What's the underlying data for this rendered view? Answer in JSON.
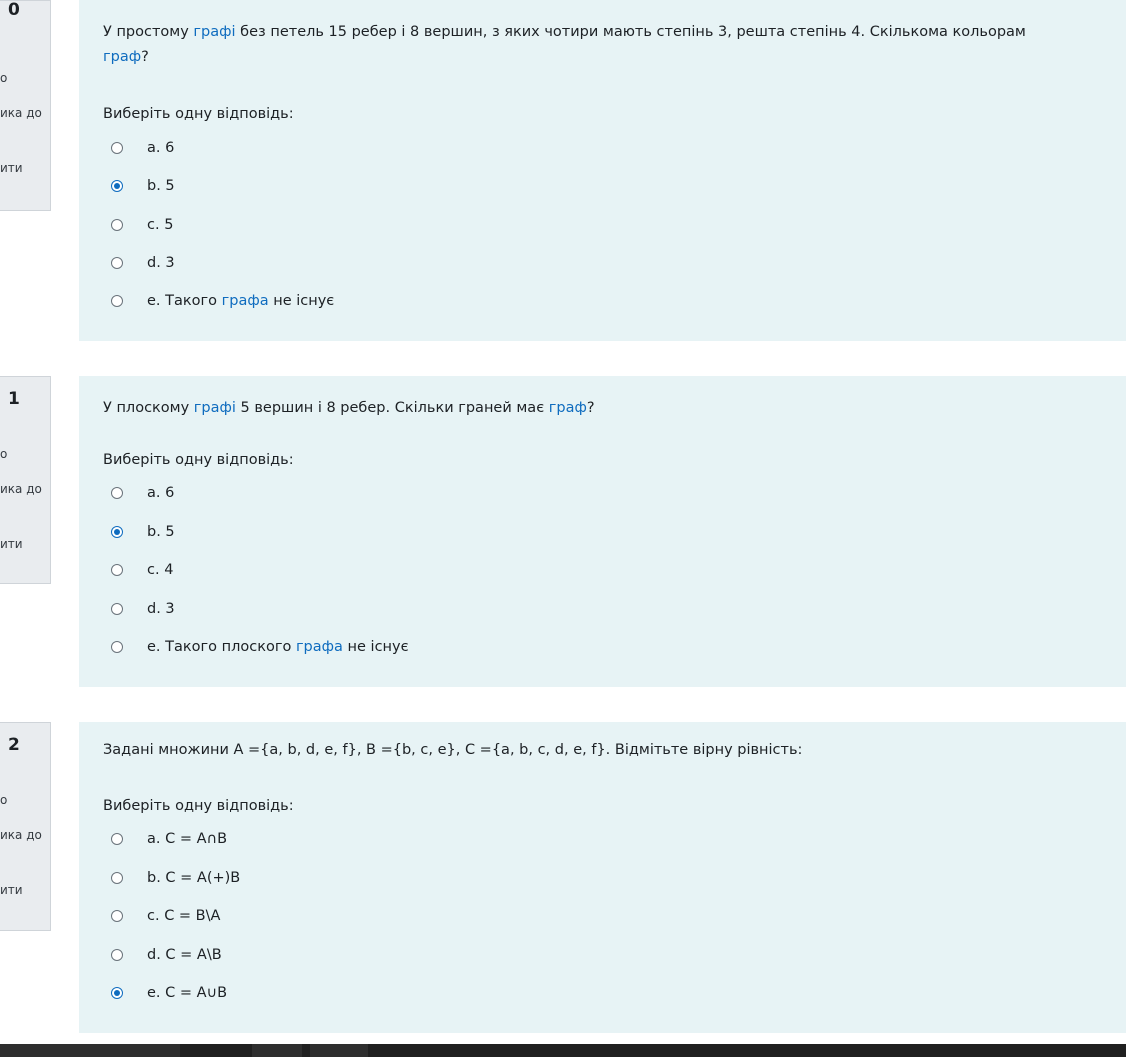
{
  "questions": [
    {
      "number": "0",
      "info": {
        "line1": "о",
        "line2": "ика до",
        "line3": "ити"
      },
      "text_parts": [
        {
          "t": "У простому ",
          "link": false
        },
        {
          "t": "графі",
          "link": true
        },
        {
          "t": " без петель 15 ребер і 8 вершин, з яких чотири мають степінь 3, решта степінь 4. Скількома кольорам",
          "link": false
        }
      ],
      "text_line2": "граф",
      "text_line2_tail": "?",
      "prompt": "Виберіть одну відповідь:",
      "answers": [
        {
          "label": "a. 6",
          "checked": false
        },
        {
          "label": "b. 5",
          "checked": true
        },
        {
          "label": "c. 5",
          "checked": false
        },
        {
          "label": "d. 3",
          "checked": false
        },
        {
          "label_pre": "e. Такого ",
          "label_link": "графа",
          "label_post": " не існує",
          "checked": false
        }
      ]
    },
    {
      "number": "1",
      "info": {
        "line1": "о",
        "line2": "ика до",
        "line3": "ити"
      },
      "text_parts": [
        {
          "t": "У плоскому ",
          "link": false
        },
        {
          "t": "графі",
          "link": true
        },
        {
          "t": " 5 вершин і 8 ребер. Скільки граней має ",
          "link": false
        },
        {
          "t": "граф",
          "link": true
        },
        {
          "t": "?",
          "link": false
        }
      ],
      "prompt": "Виберіть одну відповідь:",
      "answers": [
        {
          "label": "a. 6",
          "checked": false
        },
        {
          "label": "b. 5",
          "checked": true
        },
        {
          "label": "c. 4",
          "checked": false
        },
        {
          "label": "d. 3",
          "checked": false
        },
        {
          "label_pre": "e. Такого плоского ",
          "label_link": "графа",
          "label_post": " не існує",
          "checked": false
        }
      ]
    },
    {
      "number": "2",
      "info": {
        "line1": "о",
        "line2": "ика до",
        "line3": "ити"
      },
      "text_parts": [
        {
          "t": "Задані множини A ={a, b, d, e, f}, B ={b, c, e}, C ={a, b, c, d, e, f}. Відмітьте вірну рівність:",
          "link": false
        }
      ],
      "prompt": "Виберіть одну відповідь:",
      "answers": [
        {
          "label": "a. C = A∩B",
          "checked": false
        },
        {
          "label": "b. C = A(+)B",
          "checked": false
        },
        {
          "label": "c. C = B\\A",
          "checked": false
        },
        {
          "label": "d. C = A\\B",
          "checked": false
        },
        {
          "label": "e. C = A∪B",
          "checked": true
        }
      ]
    }
  ],
  "colors": {
    "link": "#0f6cbf",
    "content_bg": "#e7f3f5",
    "info_bg": "#e9ecef",
    "taskbar": "#202020"
  }
}
